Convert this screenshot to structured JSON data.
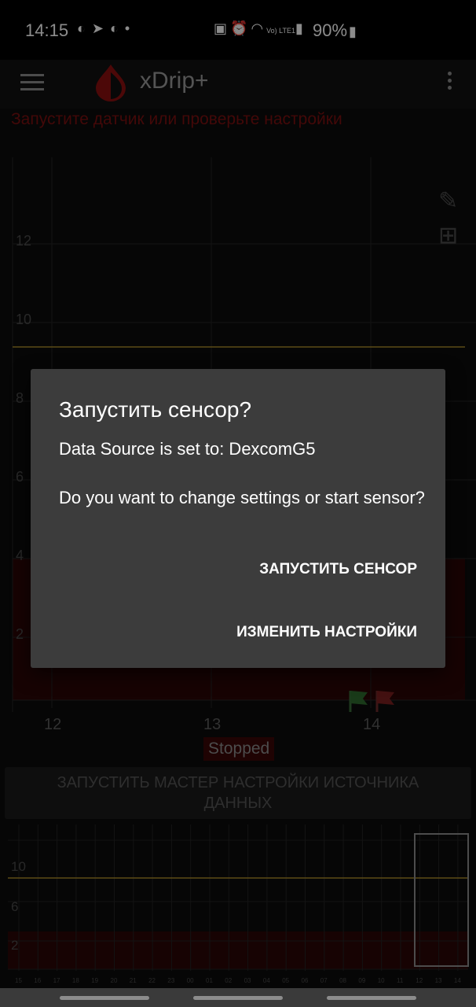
{
  "status_bar": {
    "time": "14:15",
    "battery": "90%",
    "left_icons": [
      "drop-icon",
      "telegram-icon",
      "drop-icon",
      "dot-icon"
    ],
    "right_icons": [
      "bag-icon",
      "alarm-icon",
      "wifi-icon",
      "volte-icon",
      "signal-icon",
      "battery-icon"
    ],
    "volte_label": "Vo) LTE1"
  },
  "app_bar": {
    "title": "xDrip+",
    "logo_color": "#b31212"
  },
  "warning_text": "Запустите датчик или проверьте настройки",
  "main_chart": {
    "y_ticks": [
      "12",
      "10",
      "8",
      "6",
      "4",
      "2"
    ],
    "x_ticks": [
      "12",
      "13",
      "14"
    ],
    "high_line_color": "#a8892a",
    "low_zone_color": "#3a0a0a"
  },
  "status_label": "Stopped",
  "wizard_button": "ЗАПУСТИТЬ МАСТЕР НАСТРОЙКИ ИСТОЧНИКА ДАННЫХ",
  "preview_chart": {
    "y_ticks": [
      "10",
      "6",
      "2"
    ],
    "x_ticks": [
      "15",
      "16",
      "17",
      "18",
      "19",
      "20",
      "21",
      "22",
      "23",
      "00",
      "01",
      "02",
      "03",
      "04",
      "05",
      "06",
      "07",
      "08",
      "09",
      "10",
      "11",
      "12",
      "13",
      "14"
    ]
  },
  "dialog": {
    "title": "Запустить сенсор?",
    "message_line1": "Data Source is set to: DexcomG5",
    "message_line2": "Do you want to change settings or start sensor?",
    "start_button": "ЗАПУСТИТЬ СЕНСОР",
    "settings_button": "ИЗМЕНИТЬ НАСТРОЙКИ"
  }
}
